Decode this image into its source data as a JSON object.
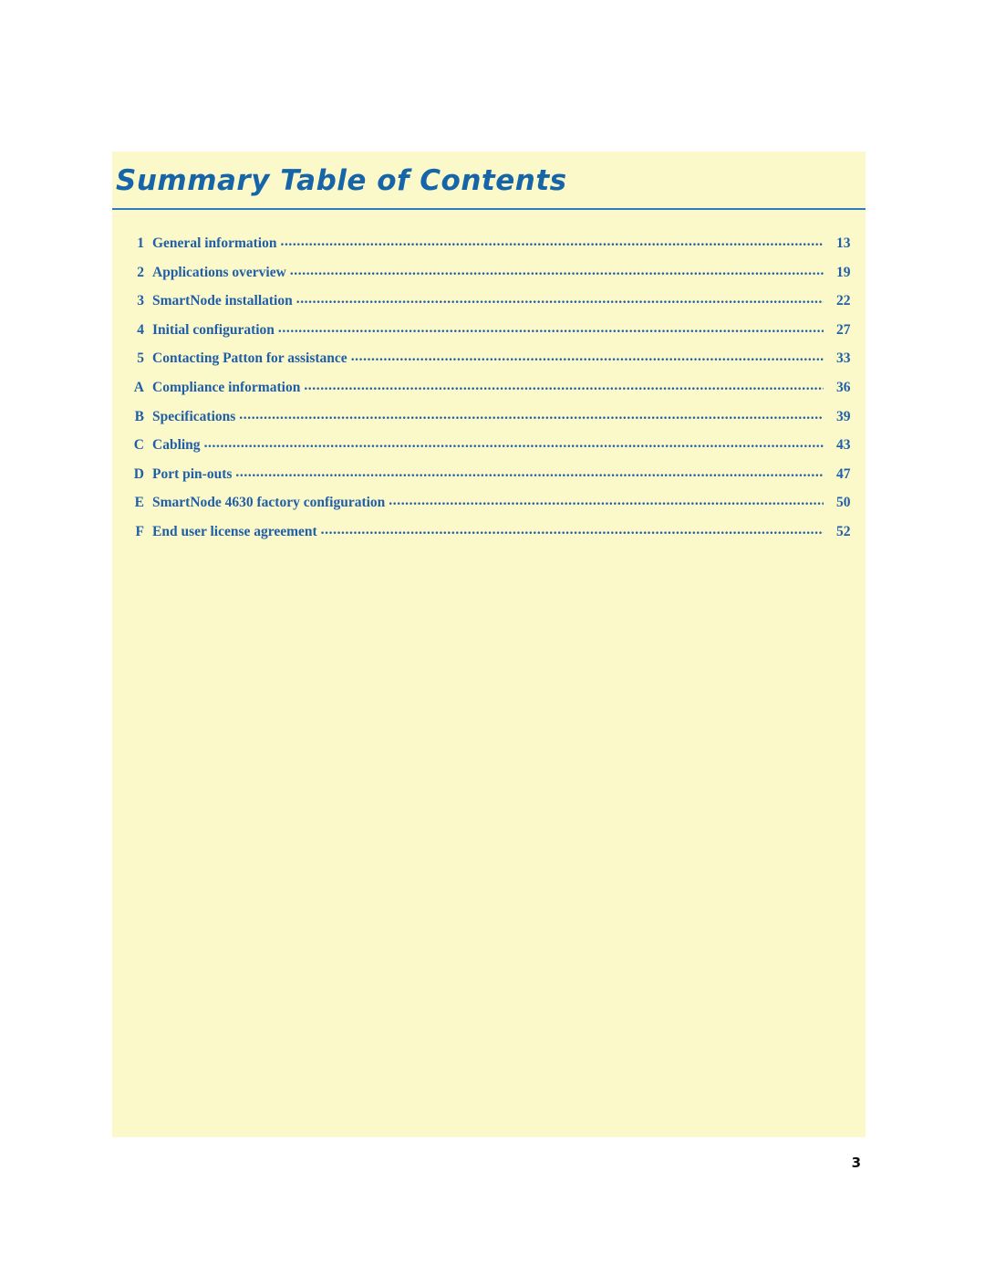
{
  "document": {
    "title": "Summary Table of Contents",
    "page_number": "3",
    "accent_color": "#1565a8",
    "panel_color": "#fbf8c9",
    "leader": "........................................................................................................................................................................................."
  },
  "toc": {
    "entries": [
      {
        "num": "1",
        "label": "General information",
        "page": "13"
      },
      {
        "num": "2",
        "label": "Applications overview",
        "page": "19"
      },
      {
        "num": "3",
        "label": "SmartNode installation",
        "page": "22"
      },
      {
        "num": "4",
        "label": "Initial configuration",
        "page": "27"
      },
      {
        "num": "5",
        "label": "Contacting Patton for assistance",
        "page": "33"
      },
      {
        "num": "A",
        "label": "Compliance information",
        "page": "36"
      },
      {
        "num": "B",
        "label": "Specifications",
        "page": "39"
      },
      {
        "num": "C",
        "label": "Cabling",
        "page": "43"
      },
      {
        "num": "D",
        "label": "Port pin-outs",
        "page": "47"
      },
      {
        "num": "E",
        "label": "SmartNode 4630 factory configuration",
        "page": "50"
      },
      {
        "num": "F",
        "label": "End user license agreement",
        "page": "52"
      }
    ]
  }
}
